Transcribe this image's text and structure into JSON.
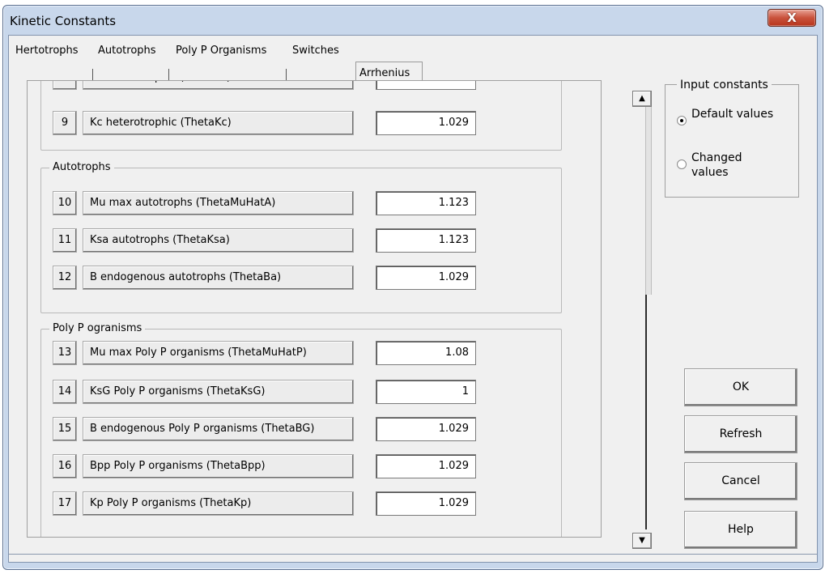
{
  "window": {
    "title": "Kinetic Constants",
    "close_label": "X"
  },
  "tabs": [
    {
      "label": "Hertotrophs"
    },
    {
      "label": "Autotrophs"
    },
    {
      "label": "Poly P Organisms"
    },
    {
      "label": "Switches"
    },
    {
      "label": "Arrhenius",
      "active": true
    }
  ],
  "heterotrophs_group": {
    "rows": [
      {
        "num": "9",
        "label": "Kc heterotrophic (ThetaKc)",
        "value": "1.029"
      }
    ]
  },
  "autotrophs_group": {
    "label": "Autotrophs",
    "rows": [
      {
        "num": "10",
        "label": "Mu max autotrophs (ThetaMuHatA)",
        "value": "1.123"
      },
      {
        "num": "11",
        "label": "Ksa autotrophs (ThetaKsa)",
        "value": "1.123"
      },
      {
        "num": "12",
        "label": "B endogenous autotrophs (ThetaBa)",
        "value": "1.029"
      }
    ]
  },
  "polyp_group": {
    "label": "Poly P ogranisms",
    "rows": [
      {
        "num": "13",
        "label": "Mu max Poly P organisms (ThetaMuHatP)",
        "value": "1.08"
      },
      {
        "num": "14",
        "label": "KsG Poly P organisms (ThetaKsG)",
        "value": "1"
      },
      {
        "num": "15",
        "label": "B endogenous Poly P organisms (ThetaBG)",
        "value": "1.029"
      },
      {
        "num": "16",
        "label": "Bpp Poly P organisms (ThetaBpp)",
        "value": "1.029"
      },
      {
        "num": "17",
        "label": "Kp Poly P organisms (ThetaKp)",
        "value": "1.029"
      }
    ]
  },
  "input_constants": {
    "legend": "Input constants",
    "default_label": "Default values",
    "changed_label": "Changed values",
    "selected": "default"
  },
  "buttons": {
    "ok": "OK",
    "refresh": "Refresh",
    "cancel": "Cancel",
    "help": "Help"
  },
  "scrollbar": {
    "up_glyph": "▲",
    "down_glyph": "▼"
  },
  "colors": {
    "close_red": "#c9523c",
    "frame": "#c8d7eb"
  }
}
